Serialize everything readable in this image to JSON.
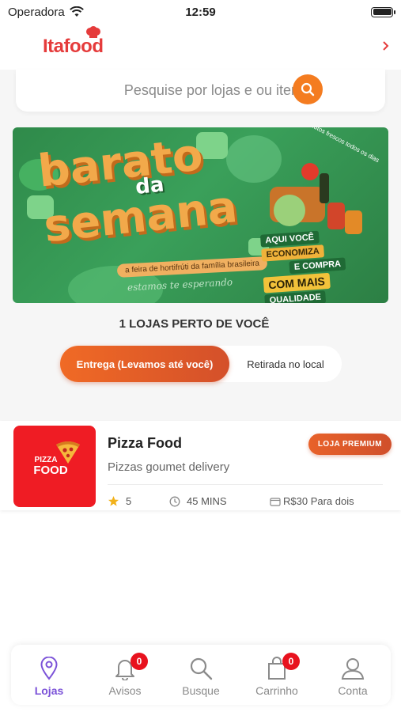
{
  "status_bar": {
    "carrier": "Operadora",
    "time": "12:59"
  },
  "header": {
    "logo": "Itafood"
  },
  "search": {
    "placeholder": "Pesquise por lojas e ou itens ..."
  },
  "banner": {
    "heading_1": "barato",
    "heading_2": "da",
    "heading_3": "semana",
    "strip": "a feira de hortifrúti da família brasileira",
    "script": "estamos te esperando",
    "curve": "Produtos frescos todos os dias",
    "badge_1": "AQUI VOCÊ",
    "badge_2": "ECONOMIZA",
    "badge_3": "E COMPRA",
    "badge_4": "COM MAIS",
    "badge_5": "QUALIDADE"
  },
  "stores": {
    "count_label": "1 LOJAS PERTO DE VOCÊ",
    "toggle_delivery": "Entrega (Levamos até você)",
    "toggle_pickup": "Retirada no local"
  },
  "store_list": [
    {
      "logo_line_1": "PIZZA",
      "logo_line_2": "FOOD",
      "name": "Pizza Food",
      "description": "Pizzas goumet delivery",
      "badge": "LOJA PREMIUM",
      "rating": "5",
      "time": "45 MINS",
      "price": "R$30 Para dois"
    }
  ],
  "tabbar": {
    "tabs": [
      {
        "label": "Lojas",
        "icon": "location-pin-icon",
        "badge": ""
      },
      {
        "label": "Avisos",
        "icon": "bell-icon",
        "badge": "0"
      },
      {
        "label": "Busque",
        "icon": "search-icon",
        "badge": ""
      },
      {
        "label": "Carrinho",
        "icon": "bag-icon",
        "badge": "0"
      },
      {
        "label": "Conta",
        "icon": "user-icon",
        "badge": ""
      }
    ]
  },
  "colors": {
    "brand_red": "#e53b3b",
    "accent_orange": "#f47c20",
    "active_tab": "#7b52d8",
    "badge_red": "#e8121e"
  }
}
